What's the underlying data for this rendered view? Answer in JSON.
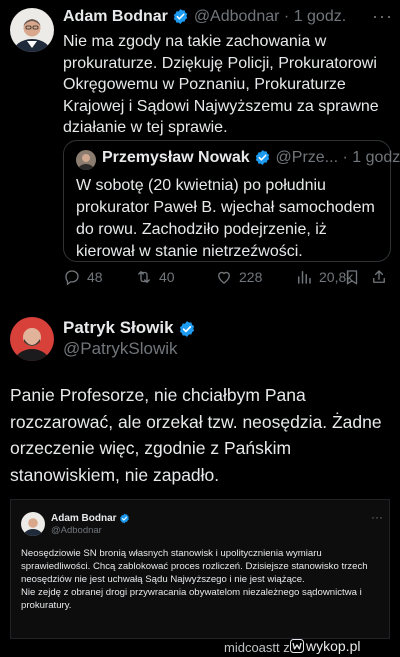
{
  "tweet1": {
    "author": "Adam Bodnar",
    "handle": "@Adbodnar",
    "dot": "·",
    "time": "1 godz.",
    "more": "···",
    "body": "Nie ma zgody na takie zachowania w prokuraturze. Dziękuję Policji, Prokuratorowi Okręgowemu w Poznaniu, Prokuraturze Krajowej i Sądowi Najwyższemu za sprawne działanie w tej sprawie.",
    "quote": {
      "author": "Przemysław Nowak",
      "handle": "@Prze...",
      "dot": "·",
      "time": "1 godz.",
      "body": "W sobotę (20 kwietnia) po południu prokurator Paweł B. wjechał samochodem do rowu. Zachodziło podejrzenie, iż kierował w stanie nietrzeźwości."
    },
    "actions": {
      "replies": "48",
      "retweets": "40",
      "likes": "228",
      "views": "20,8k"
    }
  },
  "tweet2": {
    "author": "Patryk Słowik",
    "handle": "@PatrykSlowik",
    "body": "Panie Profesorze, nie chciałbym Pana rozczarować, ale orzekał tzw. neosędzia. Żadne orzeczenie więc, zgodnie z Pańskim stanowiskiem, nie zapadło."
  },
  "embedded": {
    "author": "Adam Bodnar",
    "handle": "@Adbodnar",
    "more": "···",
    "body": "Neosędziowie SN bronią własnych stanowisk i upolitycznienia wymiaru sprawiedliwości. Chcą zablokować proces rozliczeń. Dzisiejsze stanowisko trzech neosędziów nie jest uchwałą Sądu Najwyższego i nie jest wiążące.\nNie zejdę z obranej drogi przywracania obywatelom niezależnego sądownictwa i prokuratury."
  },
  "footer": {
    "username": "midcoastt",
    "separator": "z",
    "site": "wykop.pl"
  },
  "colors": {
    "background": "#000000",
    "text": "#e7e9ea",
    "secondary": "#71767b",
    "verified": "#1d9bf0",
    "border": "#2f3336"
  }
}
